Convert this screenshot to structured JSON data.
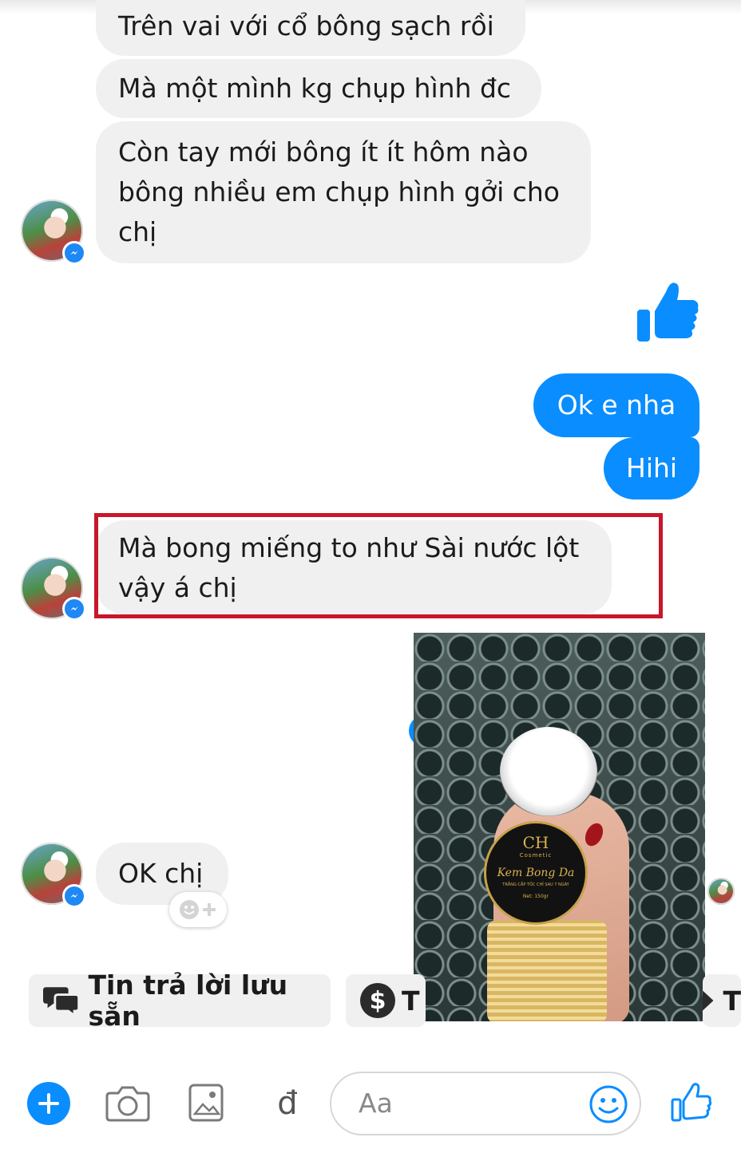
{
  "messages": {
    "incoming_group_1": [
      "Trên vai với cổ bông sạch rồi",
      "Mà một mình kg chụp hình đc",
      "Còn tay mới bông ít ít hôm nào",
      "bông nhiều em chụp hình gởi cho",
      "chị"
    ],
    "outgoing": [
      "Ok e nha",
      "Hihi"
    ],
    "highlighted": [
      "Mà bong miếng to như Sài nước lột",
      "vậy á chị"
    ],
    "incoming_last": "OK chị"
  },
  "product_photo": {
    "brand": "CH",
    "brand_sub": "Cosmetic",
    "product_name": "Kem Bong Da",
    "tagline": "TRẮNG CẤP TỐC CHỈ SAU 7 NGÀY",
    "weight": "Net: 150gr"
  },
  "quick_replies": {
    "saved": "Tin trả lời lưu sẵn",
    "second_partial": "T",
    "third_partial": "T"
  },
  "composer": {
    "placeholder": "Aa",
    "currency_symbol": "đ"
  },
  "colors": {
    "accent": "#0a8dff",
    "highlight_border": "#c8172b",
    "bubble_incoming": "#f0f0f0"
  },
  "icons": [
    "thumbs-up-icon",
    "messenger-badge-icon",
    "add-reaction-icon",
    "chat-bubbles-icon",
    "dollar-icon",
    "plus-icon",
    "camera-icon",
    "image-icon",
    "smiley-icon"
  ]
}
